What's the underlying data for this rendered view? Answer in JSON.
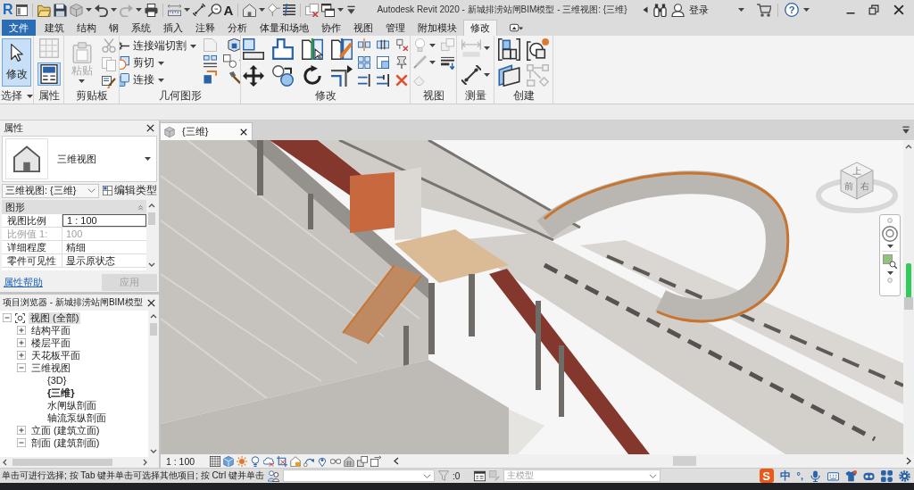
{
  "title_bar": {
    "app_logo": "R",
    "text_glyph": "A",
    "title": "Autodesk Revit 2020 - 新城排涝站闸BIM模型 - 三维视图: {三维}",
    "sign_in": "登录",
    "help_glyph": "?"
  },
  "ribbon_tabs": [
    {
      "label": "文件",
      "kind": "application",
      "selected": false
    },
    {
      "label": "建筑",
      "kind": "tab",
      "selected": false
    },
    {
      "label": "结构",
      "kind": "tab",
      "selected": false
    },
    {
      "label": "钢",
      "kind": "tab",
      "selected": false
    },
    {
      "label": "系统",
      "kind": "tab",
      "selected": false
    },
    {
      "label": "插入",
      "kind": "tab",
      "selected": false
    },
    {
      "label": "注释",
      "kind": "tab",
      "selected": false
    },
    {
      "label": "分析",
      "kind": "tab",
      "selected": false
    },
    {
      "label": "体量和场地",
      "kind": "tab",
      "selected": false
    },
    {
      "label": "协作",
      "kind": "tab",
      "selected": false
    },
    {
      "label": "视图",
      "kind": "tab",
      "selected": false
    },
    {
      "label": "管理",
      "kind": "tab",
      "selected": false
    },
    {
      "label": "附加模块",
      "kind": "tab",
      "selected": false
    },
    {
      "label": "修改",
      "kind": "tab",
      "selected": true
    }
  ],
  "ribbon": {
    "panels": [
      {
        "label": "选择",
        "kind": "select",
        "menu": true,
        "buttons": [
          {
            "label": "修改",
            "selected": true,
            "disabled": false
          }
        ]
      },
      {
        "label": "属性",
        "kind": "properties",
        "menu": false,
        "palette_shown": true
      },
      {
        "label": "剪贴板",
        "kind": "clipboard",
        "menu": false,
        "buttons": [
          {
            "label": "粘贴",
            "selected": false,
            "disabled": true
          }
        ]
      },
      {
        "label": "几何图形",
        "kind": "geometry",
        "menu": false,
        "buttons": [
          {
            "label": "连接端切割",
            "selected": false,
            "disabled": false
          },
          {
            "label": "剪切",
            "selected": false,
            "disabled": false
          },
          {
            "label": "连接",
            "selected": false,
            "disabled": false
          }
        ]
      },
      {
        "label": "修改",
        "kind": "modify",
        "menu": false
      },
      {
        "label": "视图",
        "kind": "view",
        "menu": false
      },
      {
        "label": "测量",
        "kind": "measure",
        "menu": false
      },
      {
        "label": "创建",
        "kind": "create",
        "menu": false
      }
    ]
  },
  "properties": {
    "title": "属性",
    "type_name": "三维视图",
    "instance": "三维视图: {三维}",
    "edit_type": "编辑类型",
    "group": "图形",
    "rows": [
      {
        "name": "视图比例",
        "value": "1 : 100",
        "kind": "input",
        "disabled": false
      },
      {
        "name": "比例值 1:",
        "value": "100",
        "kind": "text",
        "disabled": true
      },
      {
        "name": "详细程度",
        "value": "精细",
        "kind": "text",
        "disabled": false
      },
      {
        "name": "零件可见性",
        "value": "显示原状态",
        "kind": "text",
        "disabled": false
      }
    ],
    "help_link": "属性帮助",
    "apply": {
      "label": "应用",
      "disabled": true
    }
  },
  "project_browser": {
    "title": "项目浏览器 - 新城排涝站闸BIM模型",
    "tree": [
      {
        "label": "视图 (全部)",
        "kind": "root",
        "expanded": true,
        "selected": true,
        "children": [
          {
            "label": "结构平面",
            "kind": "group",
            "expanded": false,
            "selected": false
          },
          {
            "label": "楼层平面",
            "kind": "group",
            "expanded": false,
            "selected": false
          },
          {
            "label": "天花板平面",
            "kind": "group",
            "expanded": false,
            "selected": false
          },
          {
            "label": "三维视图",
            "kind": "group",
            "expanded": true,
            "selected": false,
            "children": [
              {
                "label": "{3D}",
                "kind": "view",
                "selected": false,
                "active": false
              },
              {
                "label": "{三维}",
                "kind": "view",
                "selected": false,
                "active": true
              },
              {
                "label": "水闸纵剖面",
                "kind": "view",
                "selected": false,
                "active": false
              },
              {
                "label": "轴流泵纵剖面",
                "kind": "view",
                "selected": false,
                "active": false
              }
            ]
          },
          {
            "label": "立面 (建筑立面)",
            "kind": "group",
            "expanded": false,
            "selected": false
          },
          {
            "label": "剖面 (建筑剖面)",
            "kind": "group",
            "expanded": true,
            "selected": false
          }
        ]
      }
    ]
  },
  "view": {
    "tab": "{三维}",
    "view_cube": {
      "top": "上",
      "front": "前",
      "right": "右"
    },
    "scale": "1 : 100"
  },
  "status_bar": {
    "hint": "单击可进行选择; 按 Tab 键并单击可选择其他项目; 按 Ctrl 键并单击",
    "filter_count": ":0",
    "model": {
      "value": "主模型",
      "disabled": true
    }
  },
  "ime_toolbar": {
    "logo": "S",
    "mode": "中",
    "punctuation": "°,"
  }
}
